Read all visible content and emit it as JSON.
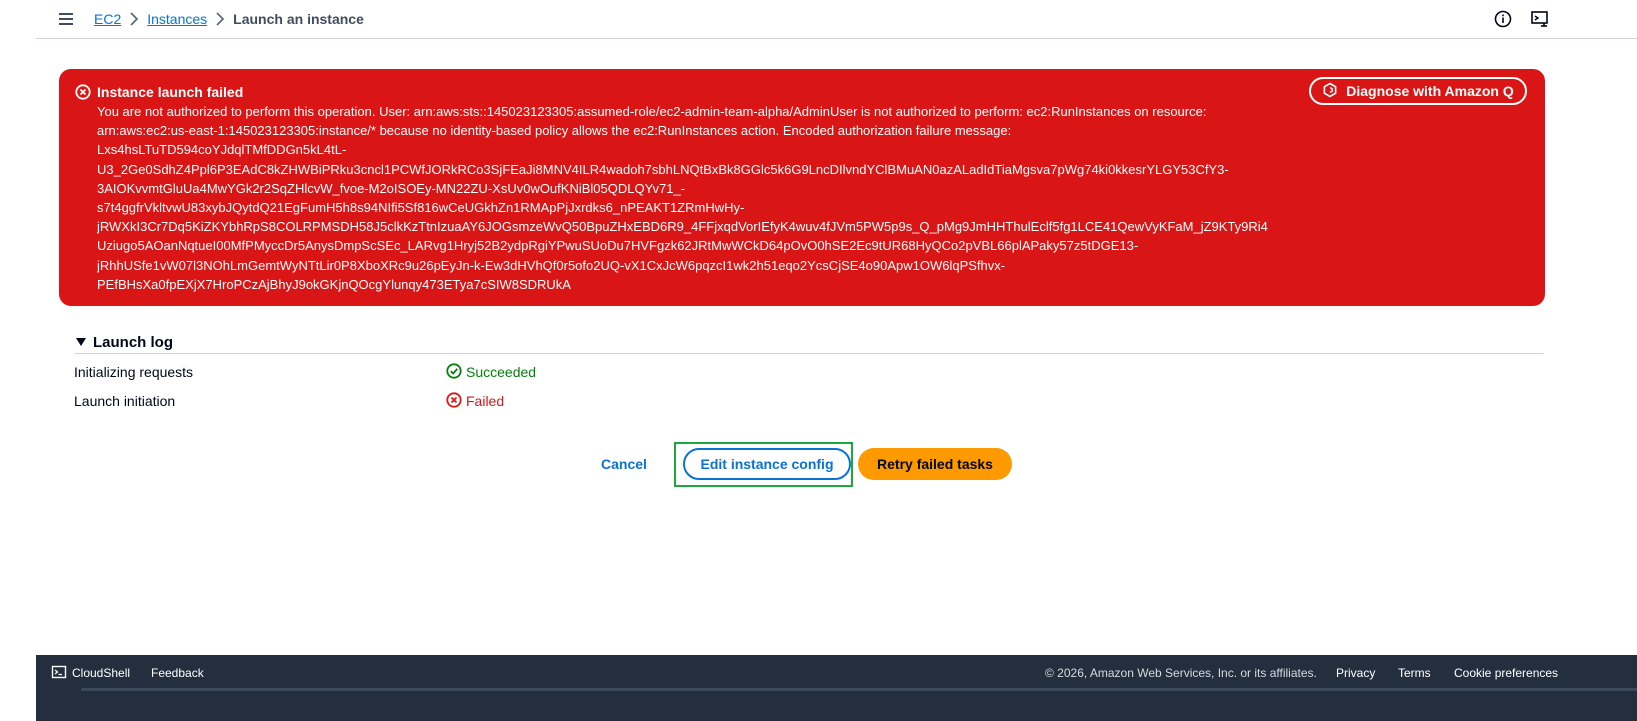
{
  "breadcrumb": {
    "items": [
      {
        "label": "EC2"
      },
      {
        "label": "Instances"
      }
    ],
    "current": "Launch an instance"
  },
  "alert": {
    "title": "Instance launch failed",
    "message_lines": [
      "You are not authorized to perform this operation. User: arn:aws:sts::145023123305:assumed-role/ec2-admin-team-alpha/AdminUser is not authorized to perform: ec2:RunInstances on resource:",
      "arn:aws:ec2:us-east-1:145023123305:instance/* because no identity-based policy allows the ec2:RunInstances action. Encoded authorization failure message:",
      "Lxs4hsLTuTD594coYJdqlTMfDDGn5kL4tL-",
      "U3_2Ge0SdhZ4Ppl6P3EAdC8kZHWBiPRku3cncl1PCWfJORkRCo3SjFEaJi8MNV4ILR4wadoh7sbhLNQtBxBk8GGlc5k6G9LncDIlvndYClBMuAN0azALadIdTiaMgsva7pWg74ki0kkesrYLGY53CfY3-",
      "3AIOKvvmtGluUa4MwYGk2r2SqZHlcvW_fvoe-M2oISOEy-MN22ZU-XsUv0wOufKNiBl05QDLQYv71_-",
      "s7t4ggfrVkltvwU83xybJQytdQ21EgFumH5h8s94NIfi5Sf816wCeUGkhZn1RMApPjJxrdks6_nPEAKT1ZRmHwHy-",
      "jRWXkI3Cr7Dq5KiZKYbhRpS8COLRPMSDH58J5clkKzTtnIzuaAY6JOGsmzeWvQ50BpuZHxEBD6R9_4FFjxqdVorIEfyK4wuv4fJVm5PW5p9s_Q_pMg9JmHHThulEclf5fg1LCE41QewVyKFaM_jZ9KTy9Ri4",
      "Uziugo5AOanNqtueI00MfPMyccDr5AnysDmpScSEc_LARvg1Hryj52B2ydpRgiYPwuSUoDu7HVFgzk62JRtMwWCkD64pOvO0hSE2Ec9tUR68HyQCo2pVBL66plAPaky57z5tDGE13-",
      "jRhhUSfe1vW07l3NOhLmGemtWyNTtLir0P8XboXRc9u26pEyJn-k-Ew3dHVhQf0r5ofo2UQ-vX1CxJcW6pqzcI1wk2h51eqo2YcsCjSE4o90Apw1OW6lqPSfhvx-",
      "PEfBHsXa0fpEXjX7HroPCzAjBhyJ9okGKjnQOcgYlunqy473ETya7cSIW8SDRUkA"
    ],
    "diagnose_label": "Diagnose with Amazon Q"
  },
  "launch_log": {
    "title": "Launch log",
    "rows": [
      {
        "label": "Initializing requests",
        "status": "Succeeded"
      },
      {
        "label": "Launch initiation",
        "status": "Failed"
      }
    ]
  },
  "actions": {
    "cancel": "Cancel",
    "edit": "Edit instance config",
    "retry": "Retry failed tasks"
  },
  "footer": {
    "cloudshell": "CloudShell",
    "feedback": "Feedback",
    "copyright": "© 2026, Amazon Web Services, Inc. or its affiliates.",
    "privacy": "Privacy",
    "terms": "Terms",
    "cookies": "Cookie preferences"
  },
  "colors": {
    "error": "#d91515",
    "link": "#0972d3",
    "success": "#037f0c",
    "primary_button": "#ff9900",
    "footer_bg": "#232f3e"
  }
}
